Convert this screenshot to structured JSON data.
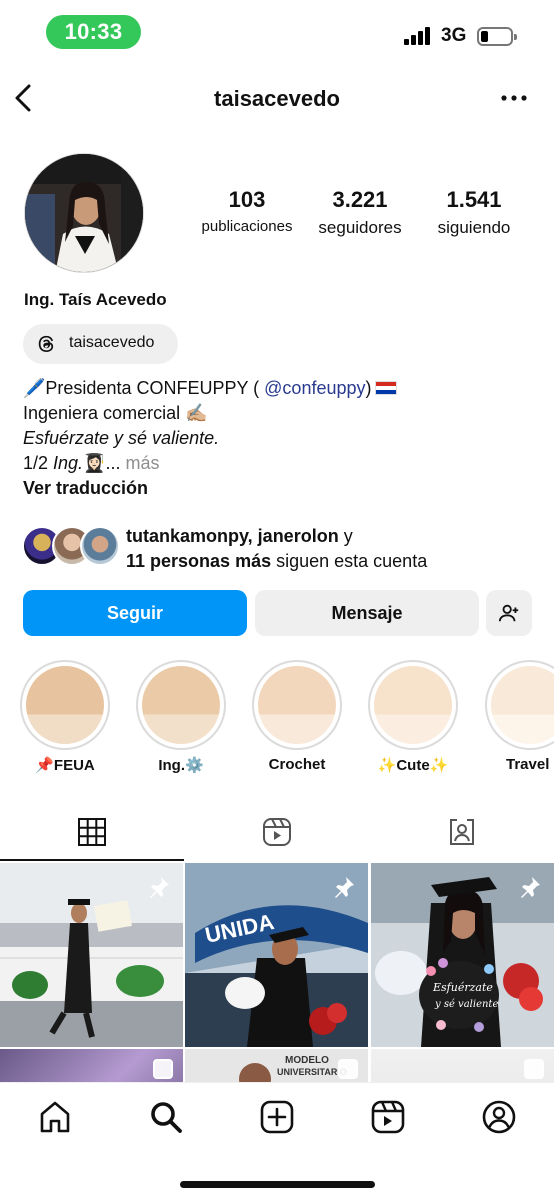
{
  "status_bar": {
    "time": "10:33",
    "network": "3G"
  },
  "header": {
    "username": "taisacevedo"
  },
  "profile": {
    "stats": [
      {
        "value": "103",
        "label": "publicaciones"
      },
      {
        "value": "3.221",
        "label": "seguidores"
      },
      {
        "value": "1.541",
        "label": "siguiendo"
      }
    ],
    "full_name": "Ing. Taís Acevedo",
    "threads_handle": "taisacevedo",
    "bio": {
      "line1_prefix": "🖊️Presidenta CONFEUPPY ( ",
      "line1_mention": "@confeuppy",
      "line1_suffix": ")",
      "line2": "Ingeniera comercial ✍🏼",
      "line3": "Esfuérzate y sé valiente.",
      "line4_prefix": "1/2 ",
      "line4_italic": "Ing.",
      "line4_emoji": "👩🏻‍🎓...",
      "line4_more": " más",
      "translate": "Ver traducción"
    },
    "followed_by": {
      "names": "tutankamonpy, janerolon",
      "connector": " y",
      "count_bold": "11 personas más",
      "suffix": " siguen esta cuenta"
    }
  },
  "buttons": {
    "follow": "Seguir",
    "message": "Mensaje"
  },
  "highlights": [
    {
      "label": "📌FEUA",
      "color_top": "#e7c39f",
      "color_bottom": "#f1dcc6"
    },
    {
      "label": "Ing.⚙️",
      "color_top": "#ebcaa8",
      "color_bottom": "#f3e0cb"
    },
    {
      "label": "Crochet",
      "color_top": "#f2d7bd",
      "color_bottom": "#f8e9da"
    },
    {
      "label": "✨Cute✨",
      "color_top": "#f7e2cc",
      "color_bottom": "#fbeee1"
    },
    {
      "label": "Travel",
      "color_top": "#f9e9d8",
      "color_bottom": "#fdf4ea"
    }
  ],
  "grid_captions": {
    "cap_text_1": "Esfuérzate",
    "cap_text_2": "y sé valiente",
    "building_sign": "UNIDA",
    "poster_line_1": "MODELO",
    "poster_line_2": "UNIVERSITARIO"
  },
  "colors": {
    "accent": "#0095f6",
    "mention": "#2a3b8f",
    "time_pill": "#34c759"
  }
}
